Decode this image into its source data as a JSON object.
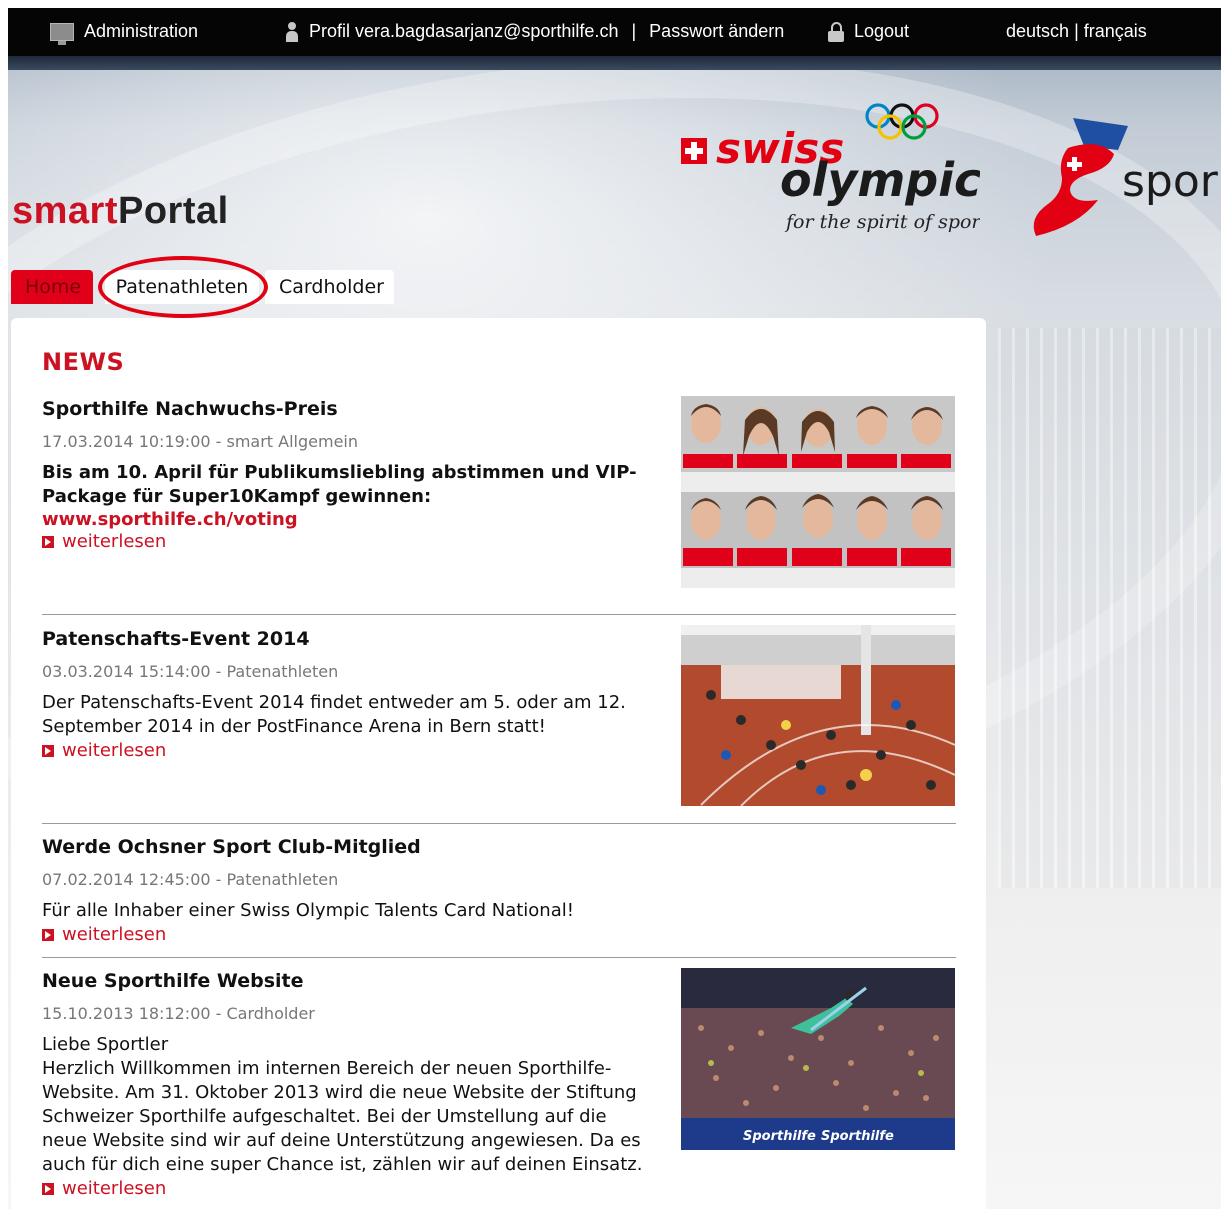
{
  "topbar": {
    "admin_label": "Administration",
    "profile_prefix": "Profil",
    "profile_email": "vera.bagdasarjanz@sporthilfe.ch",
    "separator": "|",
    "password_label": "Passwort ändern",
    "logout_label": "Logout",
    "lang_de": "deutsch",
    "lang_sep": "|",
    "lang_fr": "français"
  },
  "logos": {
    "swiss_word": "swiss",
    "olympic_word": "olympic",
    "tagline": "for the spirit of sport",
    "sport_word": "spor"
  },
  "brand": {
    "part1": "smart",
    "part2": "Portal"
  },
  "tabs": [
    {
      "label": "Home",
      "active": true
    },
    {
      "label": "Patenathleten",
      "active": false,
      "highlighted": true
    },
    {
      "label": "Cardholder",
      "active": false
    }
  ],
  "news": {
    "heading": "NEWS",
    "read_more": "weiterlesen",
    "items": [
      {
        "title": "Sporthilfe Nachwuchs-Preis",
        "meta": "17.03.2014 10:19:00 - smart Allgemein",
        "body": "Bis am 10. April für Publikumsliebling abstimmen und VIP-Package für Super10Kampf gewinnen:",
        "link": "www.sporthilfe.ch/voting",
        "image": "athlete-portrait-grid"
      },
      {
        "title": "Patenschafts-Event 2014",
        "meta": "03.03.2014 15:14:00 - Patenathleten",
        "body": "Der Patenschafts-Event 2014 findet entweder am 5. oder am 12. September 2014 in der PostFinance Arena in Bern statt!",
        "image": "event-hall-crowd"
      },
      {
        "title": "Werde Ochsner Sport Club-Mitglied",
        "meta": "07.02.2014 12:45:00 - Patenathleten",
        "body": "Für alle Inhaber einer Swiss Olympic Talents Card National!"
      },
      {
        "title": "Neue Sporthilfe Website",
        "meta": "15.10.2013 18:12:00 - Cardholder",
        "body_lines": [
          "Liebe Sportler",
          "Herzlich Willkommen im internen Bereich der neuen Sporthilfe-Website. Am 31. Oktober 2013 wird die neue Website der Stiftung Schweizer Sporthilfe aufgeschaltet. Bei der Umstellung auf die neue Website sind wir auf deine Unterstützung angewiesen. Da es auch für dich eine super Chance ist, zählen wir auf deinen Einsatz."
        ],
        "image": "ski-jumper-stadium",
        "banner_text": "Sporthilfe"
      }
    ]
  },
  "colors": {
    "accent": "#cc1122",
    "topbar": "#050505",
    "highlight": "#e20013"
  }
}
